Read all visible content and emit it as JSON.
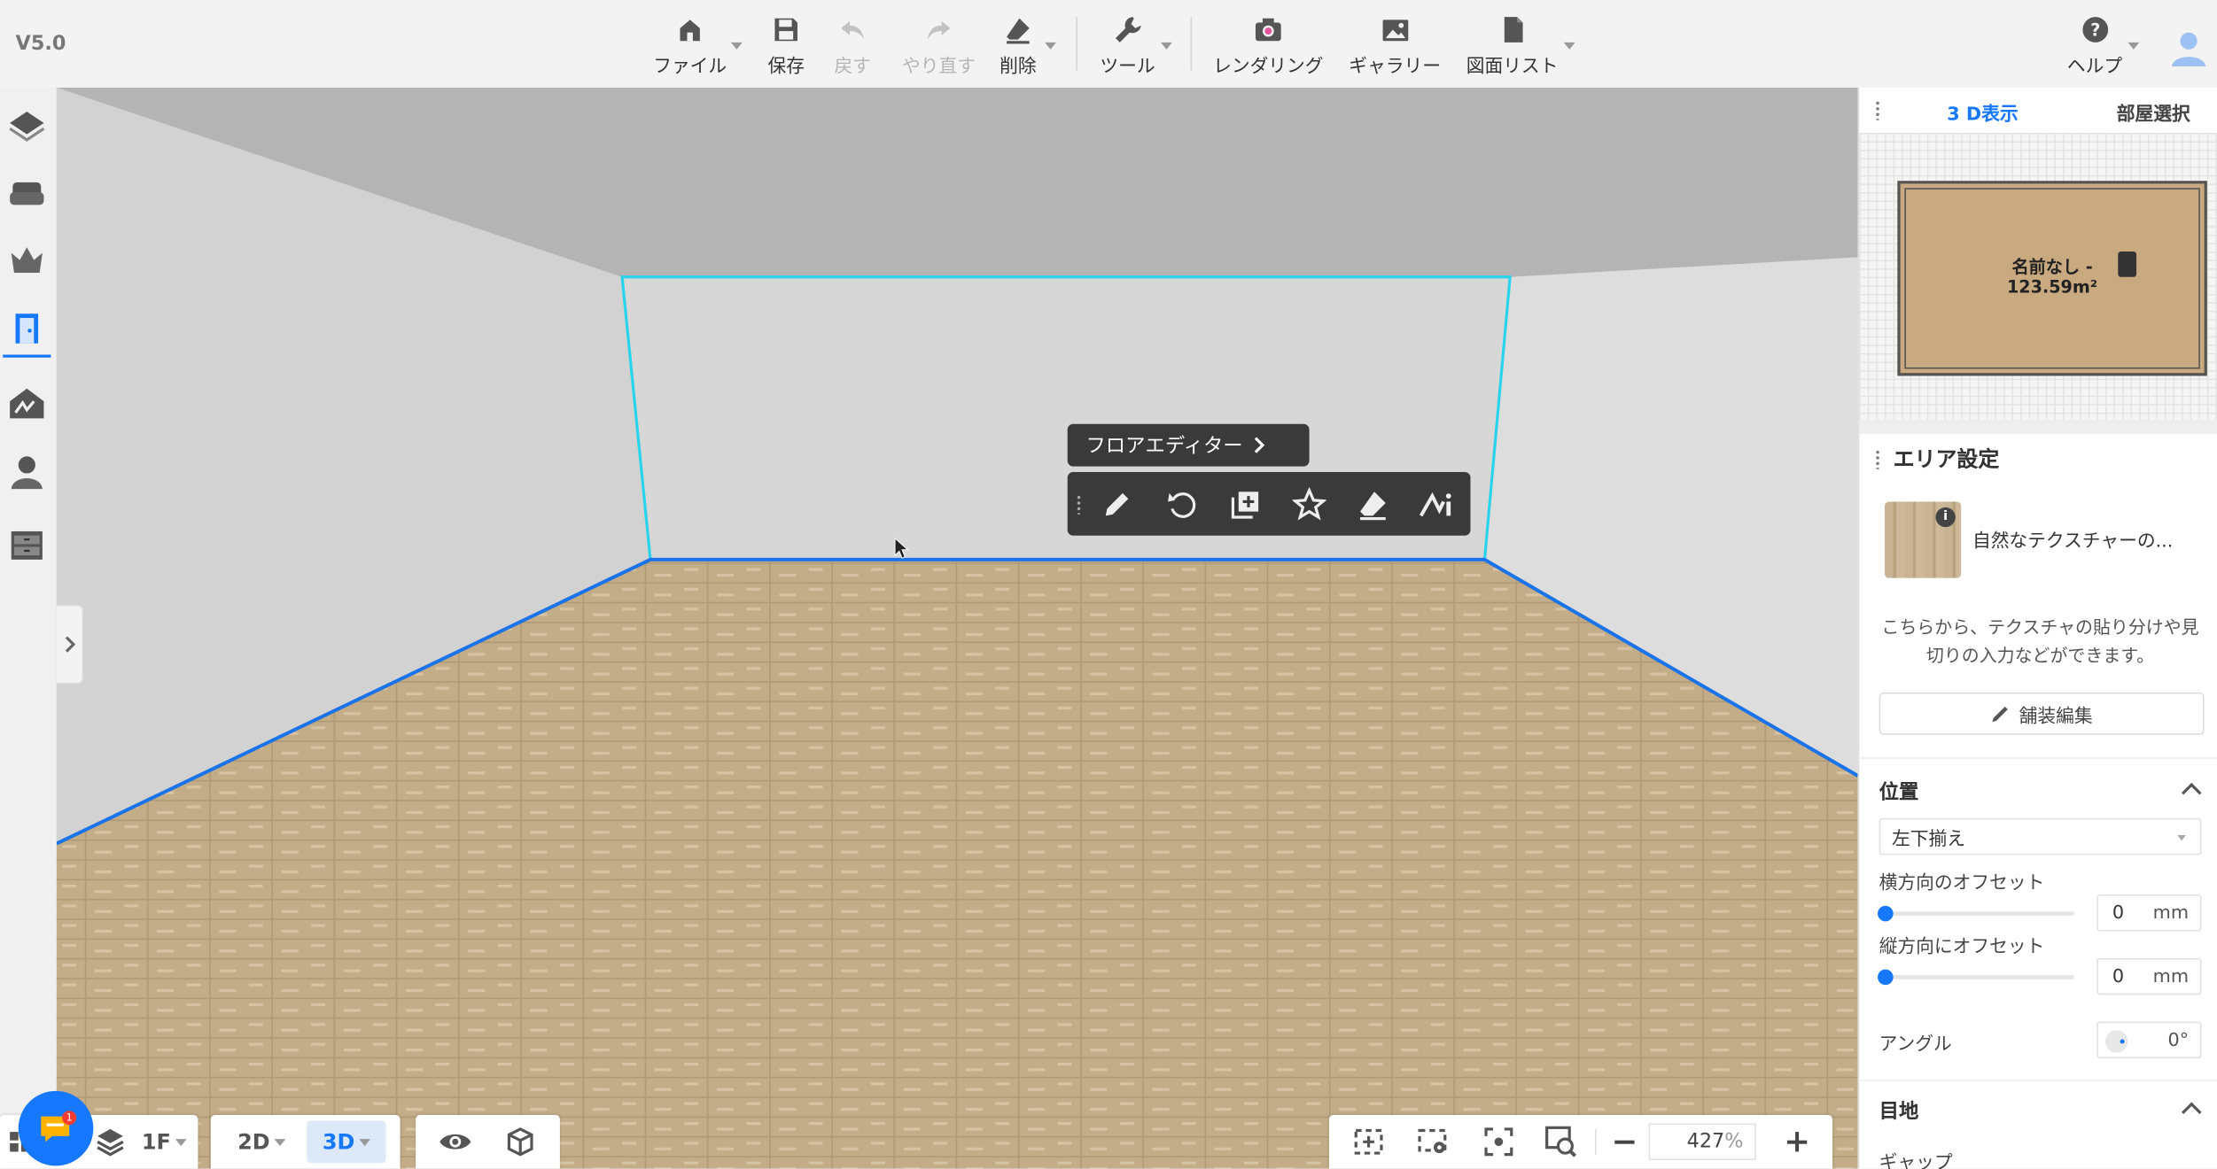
{
  "app": {
    "version": "V5.0"
  },
  "toolbar": {
    "file": "ファイル",
    "save": "保存",
    "undo": "戻す",
    "redo": "やり直す",
    "delete": "削除",
    "tools": "ツール",
    "rendering": "レンダリング",
    "gallery": "ギャラリー",
    "drawing_list": "図面リスト",
    "help": "ヘルプ"
  },
  "floor_editor": {
    "label": "フロアエディター"
  },
  "right_panel": {
    "tabs": {
      "view3d": "3 D表示",
      "room_select": "部屋選択"
    },
    "minimap": {
      "room_name": "名前なし -",
      "room_area": "123.59m²"
    },
    "area_settings": {
      "title": "エリア設定",
      "texture_name": "自然なテクスチャーの...",
      "info_badge": "i",
      "description": "こちらから、テクスチャの貼り分けや見切りの入力などができます。",
      "edit_button": "舗装編集"
    },
    "position": {
      "title": "位置",
      "align_value": "左下揃え",
      "h_offset_label": "横方向のオフセット",
      "h_offset_value": "0",
      "v_offset_label": "縦方向にオフセット",
      "v_offset_value": "0",
      "unit": "mm",
      "h_offset_fraction": 0,
      "v_offset_fraction": 0,
      "angle_label": "アングル",
      "angle_value": "0°"
    },
    "joint": {
      "title": "目地",
      "gap_label": "ギャップ"
    }
  },
  "bottom": {
    "floor": "1F",
    "mode_2d": "2D",
    "mode_3d": "3D",
    "zoom_value": "427",
    "zoom_unit": "%",
    "chat_badge": "1"
  },
  "colors": {
    "accent": "#1677ff",
    "wall_highlight": "#29d3ec",
    "floor_outline": "#1a73e8",
    "floor_wood": "#c3ac88"
  }
}
